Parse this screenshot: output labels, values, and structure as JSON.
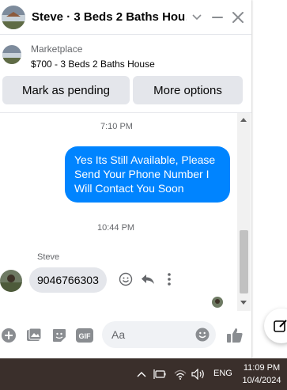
{
  "header": {
    "title": "Steve · 3 Beds 2 Baths Hou…",
    "icons": [
      "chevron-down-icon",
      "minimize-icon",
      "close-icon"
    ]
  },
  "marketplace": {
    "label": "Marketplace",
    "listing": "$700 - 3 Beds 2 Baths House"
  },
  "actions": {
    "pending_label": "Mark as pending",
    "more_label": "More options"
  },
  "messages": {
    "timestamp_1": "7:10 PM",
    "outgoing_text": "Yes Its Still Available, Please Send Your Phone Number I Will Contact You Soon",
    "timestamp_2": "10:44 PM",
    "sender_name": "Steve",
    "incoming_text": "9046766303",
    "message_actions": [
      "react-icon",
      "reply-icon",
      "more-icon"
    ]
  },
  "composer": {
    "placeholder": "Aa",
    "icons": [
      "plus-icon",
      "photo-icon",
      "sticker-icon",
      "gif-icon",
      "emoji-icon",
      "like-icon"
    ]
  },
  "taskbar": {
    "language": "ENG",
    "time": "11:09 PM",
    "date": "10/4/2024",
    "icons": [
      "chevron-up-icon",
      "battery-icon",
      "wifi-icon",
      "speaker-icon"
    ]
  },
  "colors": {
    "outgoing_bubble": "#0084ff",
    "incoming_bubble": "#e4e6eb",
    "button_bg": "#e4e6eb",
    "taskbar_bg": "#3a2f2b",
    "icon_gray": "#8a8d91"
  }
}
